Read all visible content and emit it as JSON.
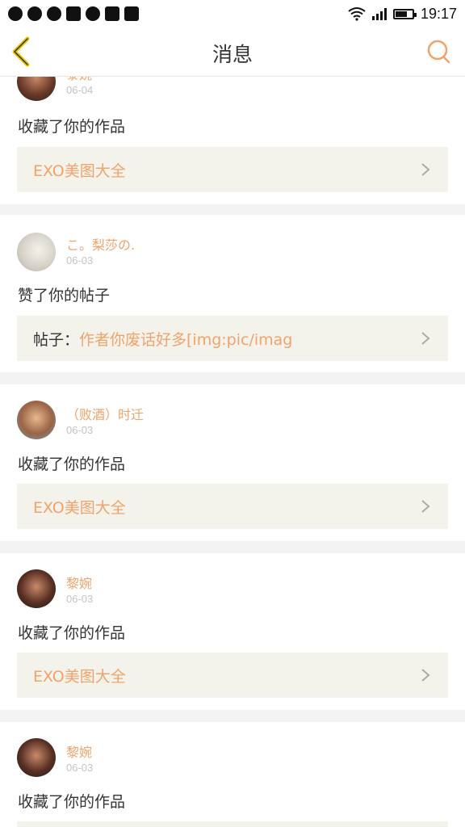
{
  "statusbar": {
    "time": "19:17"
  },
  "nav": {
    "title": "消息"
  },
  "messages": [
    {
      "name": "黎婉",
      "date": "06-04",
      "action": "收藏了你的作品",
      "ref_prefix": "",
      "ref_text": "EXO美图大全"
    },
    {
      "name": "こ。梨莎の.",
      "date": "06-03",
      "action": "赞了你的帖子",
      "ref_prefix": "帖子：",
      "ref_text": "作者你废话好多[img:pic/imag"
    },
    {
      "name": "（败酒）时迁",
      "date": "06-03",
      "action": "收藏了你的作品",
      "ref_prefix": "",
      "ref_text": "EXO美图大全"
    },
    {
      "name": "黎婉",
      "date": "06-03",
      "action": "收藏了你的作品",
      "ref_prefix": "",
      "ref_text": "EXO美图大全"
    },
    {
      "name": "黎婉",
      "date": "06-03",
      "action": "收藏了你的作品",
      "ref_prefix": "",
      "ref_text": ""
    }
  ],
  "colors": {
    "accent": "#f0a36a",
    "back_arrow": "#e9c400",
    "search": "#f0a36a"
  },
  "icons": {
    "back": "back-arrow-icon",
    "search": "search-icon",
    "chevron": "chevron-right-icon"
  }
}
